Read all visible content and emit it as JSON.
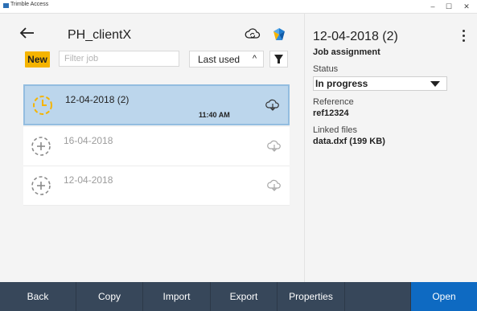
{
  "window": {
    "title": "Trimble Access",
    "minimize": "–",
    "maximize": "☐",
    "close": "✕"
  },
  "header": {
    "title": "PH_clientX"
  },
  "toolbar": {
    "new_label": "New",
    "filter_placeholder": "Filter job",
    "sort_label": "Last used",
    "sort_chevron": "^"
  },
  "jobs": [
    {
      "name": "12-04-2018 (2)",
      "time": "11:40 AM"
    },
    {
      "name": "16-04-2018",
      "time": ""
    },
    {
      "name": "12-04-2018",
      "time": ""
    }
  ],
  "details": {
    "title": "12-04-2018 (2)",
    "subtitle": "Job assignment",
    "status_label": "Status",
    "status_value": "In progress",
    "reference_label": "Reference",
    "reference_value": "ref12324",
    "linked_label": "Linked files",
    "linked_value": "data.dxf (199 KB)"
  },
  "bottom": {
    "back": "Back",
    "copy": "Copy",
    "import": "Import",
    "export": "Export",
    "properties": "Properties",
    "open": "Open"
  },
  "colors": {
    "accent_yellow": "#f5b400",
    "bottom_bar": "#37475a",
    "open_blue": "#0e6ac2",
    "selected_row": "#bcd6ec"
  },
  "icons": [
    "app-icon",
    "back-arrow-icon",
    "cloud-sync-icon",
    "trimble-connect-icon",
    "funnel-icon",
    "clock-icon",
    "plus-dashed-icon",
    "cloud-download-icon",
    "kebab-icon",
    "caret-down-icon"
  ]
}
